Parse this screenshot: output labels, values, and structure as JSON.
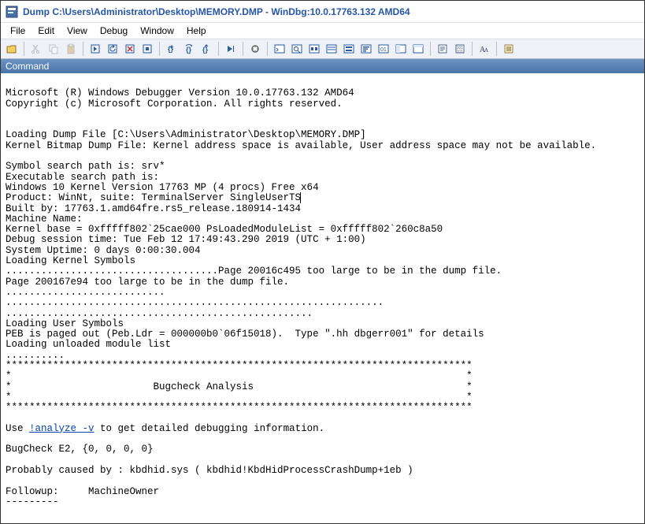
{
  "window": {
    "title": "Dump C:\\Users\\Administrator\\Desktop\\MEMORY.DMP - WinDbg:10.0.17763.132 AMD64"
  },
  "menu": {
    "file": "File",
    "edit": "Edit",
    "view": "View",
    "debug": "Debug",
    "window": "Window",
    "help": "Help"
  },
  "panel": {
    "title": "Command"
  },
  "analyze_link": "!analyze -v",
  "output_pre": "\nMicrosoft (R) Windows Debugger Version 10.0.17763.132 AMD64\nCopyright (c) Microsoft Corporation. All rights reserved.\n\n\nLoading Dump File [C:\\Users\\Administrator\\Desktop\\MEMORY.DMP]\nKernel Bitmap Dump File: Kernel address space is available, User address space may not be available.\n\nSymbol search path is: srv*\nExecutable search path is:\nWindows 10 Kernel Version 17763 MP (4 procs) Free x64\nProduct: WinNt, suite: TerminalServer SingleUserTS",
  "output_post": "\nBuilt by: 17763.1.amd64fre.rs5_release.180914-1434\nMachine Name:\nKernel base = 0xfffff802`25cae000 PsLoadedModuleList = 0xfffff802`260c8a50\nDebug session time: Tue Feb 12 17:49:43.290 2019 (UTC + 1:00)\nSystem Uptime: 0 days 0:00:30.004\nLoading Kernel Symbols\n....................................Page 20016c495 too large to be in the dump file.\nPage 200167e94 too large to be in the dump file.\n...........................\n................................................................\n....................................................\nLoading User Symbols\nPEB is paged out (Peb.Ldr = 000000b0`06f15018).  Type \".hh dbgerr001\" for details\nLoading unloaded module list\n..........\n*******************************************************************************\n*                                                                             *\n*                        Bugcheck Analysis                                    *\n*                                                                             *\n*******************************************************************************\n\nUse ",
  "output_after_link": " to get detailed debugging information.\n\nBugCheck E2, {0, 0, 0, 0}\n\nProbably caused by : kbdhid.sys ( kbdhid!KbdHidProcessCrashDump+1eb )\n\nFollowup:     MachineOwner\n---------\n"
}
